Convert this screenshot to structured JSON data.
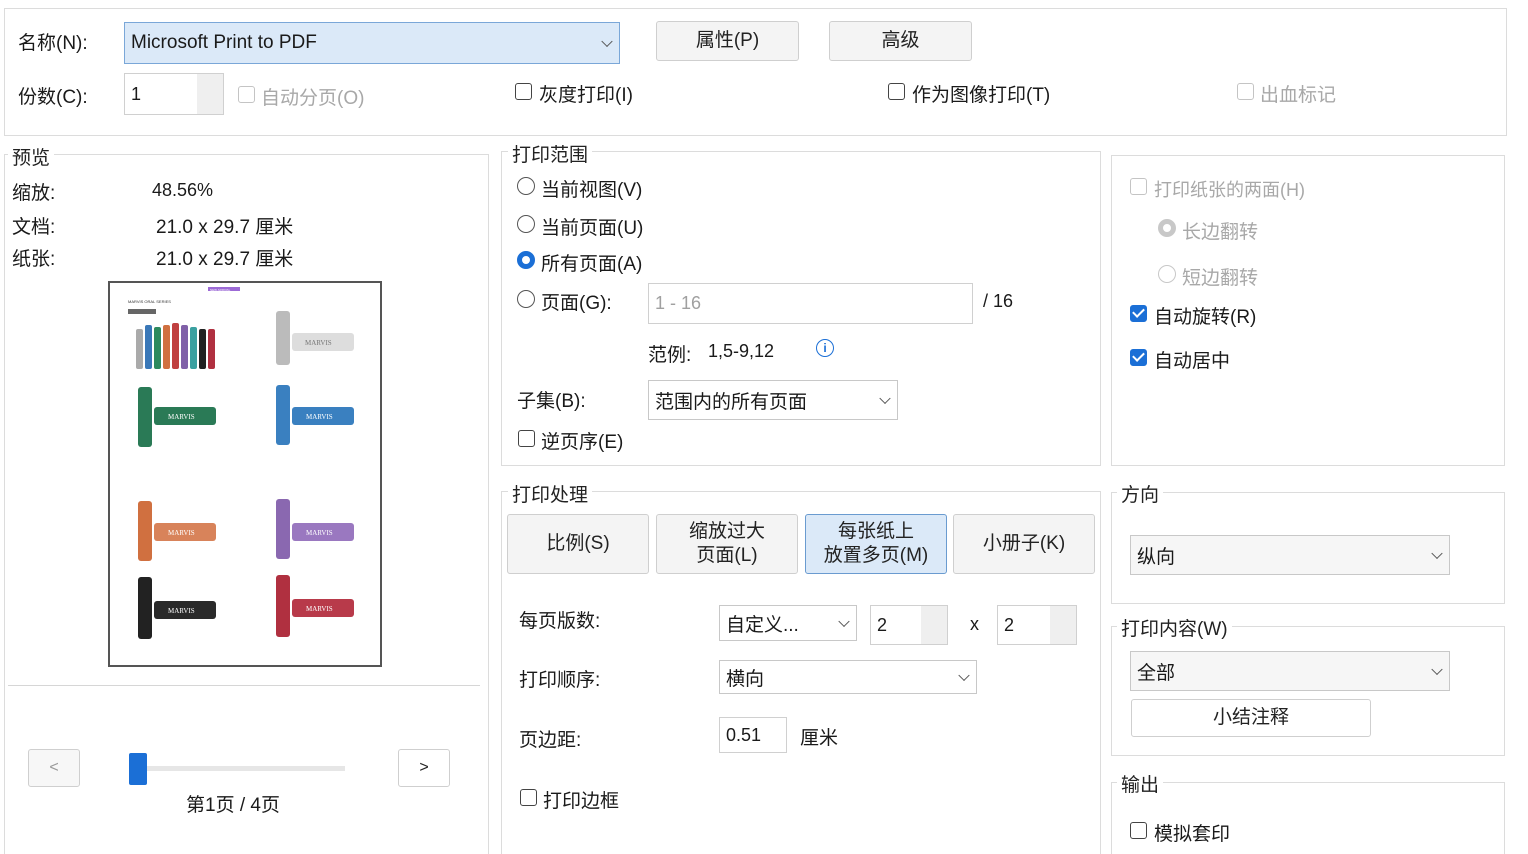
{
  "top": {
    "name_label": "名称(N):",
    "printer_value": "Microsoft Print to PDF",
    "properties_button": "属性(P)",
    "advanced_button": "高级",
    "copies_label": "份数(C):",
    "copies_value": "1",
    "collate_label": "自动分页(O)",
    "grayscale_label": "灰度打印(I)",
    "print_as_image_label": "作为图像打印(T)",
    "bleed_marks_label": "出血标记"
  },
  "preview": {
    "title": "预览",
    "zoom_label": "缩放:",
    "zoom_value": "48.56%",
    "document_label": "文档:",
    "document_value": "21.0 x 29.7 厘米",
    "paper_label": "纸张:",
    "paper_value": "21.0 x 29.7 厘米",
    "prev_button": "<",
    "next_button": ">",
    "page_indicator": "第1页 / 4页",
    "thumb_header_text": "MARVIS ORAL SERIES",
    "thumb_tag": "NEW ARRIVAL",
    "thumb_brand": "MARVIS"
  },
  "range": {
    "title": "打印范围",
    "current_view": "当前视图(V)",
    "current_page": "当前页面(U)",
    "all_pages": "所有页面(A)",
    "pages": "页面(G):",
    "pages_placeholder": "1 - 16",
    "pages_total": "/ 16",
    "example_label": "范例:",
    "example_value": "1,5-9,12",
    "subset_label": "子集(B):",
    "subset_value": "范围内的所有页面",
    "reverse_label": "逆页序(E)"
  },
  "duplex": {
    "both_sides": "打印纸张的两面(H)",
    "long_edge": "长边翻转",
    "short_edge": "短边翻转",
    "auto_rotate": "自动旋转(R)",
    "auto_center": "自动居中"
  },
  "handling": {
    "title": "打印处理",
    "btn_scale": "比例(S)",
    "btn_shrink": "缩放过大\n页面(L)",
    "btn_multiple": "每张纸上\n放置多页(M)",
    "btn_booklet": "小册子(K)",
    "pages_per_sheet_label": "每页版数:",
    "pages_per_sheet_value": "自定义...",
    "cols_value": "2",
    "times": "x",
    "rows_value": "2",
    "order_label": "打印顺序:",
    "order_value": "横向",
    "margin_label": "页边距:",
    "margin_value": "0.51",
    "margin_unit": "厘米",
    "border_label": "打印边框"
  },
  "orientation": {
    "title": "方向",
    "value": "纵向"
  },
  "content": {
    "title": "打印内容(W)",
    "value": "全部",
    "summarize_button": "小结注释"
  },
  "output": {
    "title": "输出",
    "simulate_overprint": "模拟套印"
  },
  "colors": {
    "accent": "#1b6fd6",
    "selected_field": "#dbe9f8",
    "slider": "#1b6fd6"
  }
}
